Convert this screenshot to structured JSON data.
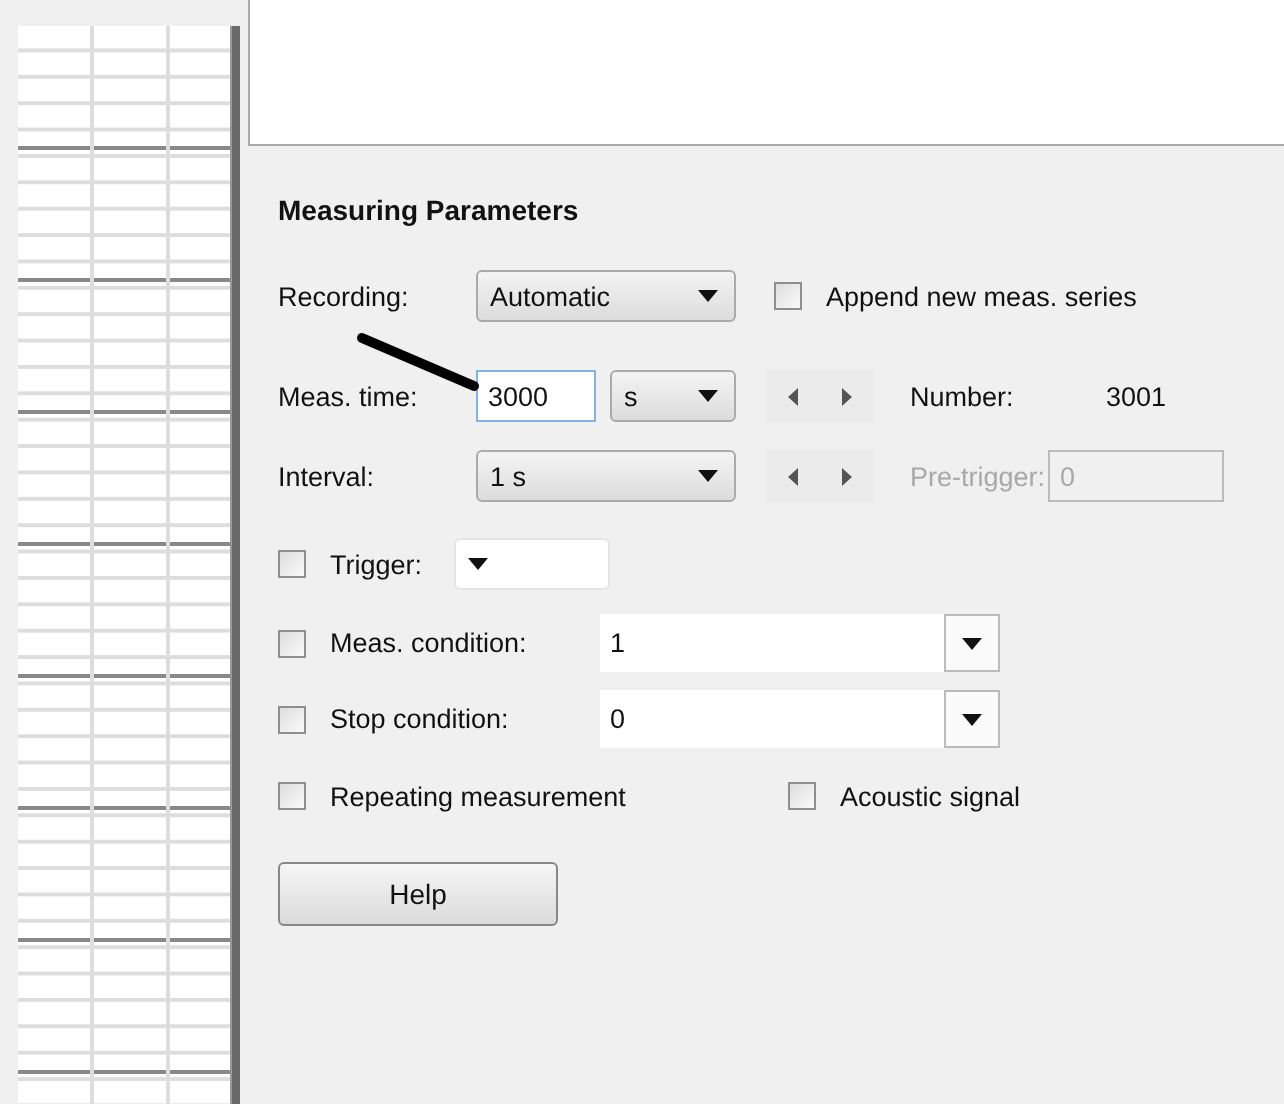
{
  "section_title": "Measuring Parameters",
  "recording": {
    "label": "Recording:",
    "value": "Automatic"
  },
  "append_series": {
    "label": "Append new meas. series",
    "checked": false
  },
  "meas_time": {
    "label": "Meas. time:",
    "value": "3000",
    "unit": "s"
  },
  "number": {
    "label": "Number:",
    "value": "3001"
  },
  "interval": {
    "label": "Interval:",
    "value": "1 s"
  },
  "pre_trigger": {
    "label": "Pre-trigger:",
    "value": "0",
    "disabled": true
  },
  "trigger": {
    "label": "Trigger:",
    "checked": false
  },
  "meas_condition": {
    "label": "Meas. condition:",
    "value": "1",
    "checked": false
  },
  "stop_condition": {
    "label": "Stop condition:",
    "value": "0",
    "checked": false
  },
  "repeating": {
    "label": "Repeating measurement",
    "checked": false
  },
  "acoustic": {
    "label": "Acoustic signal",
    "checked": false
  },
  "buttons": [
    "Help"
  ]
}
